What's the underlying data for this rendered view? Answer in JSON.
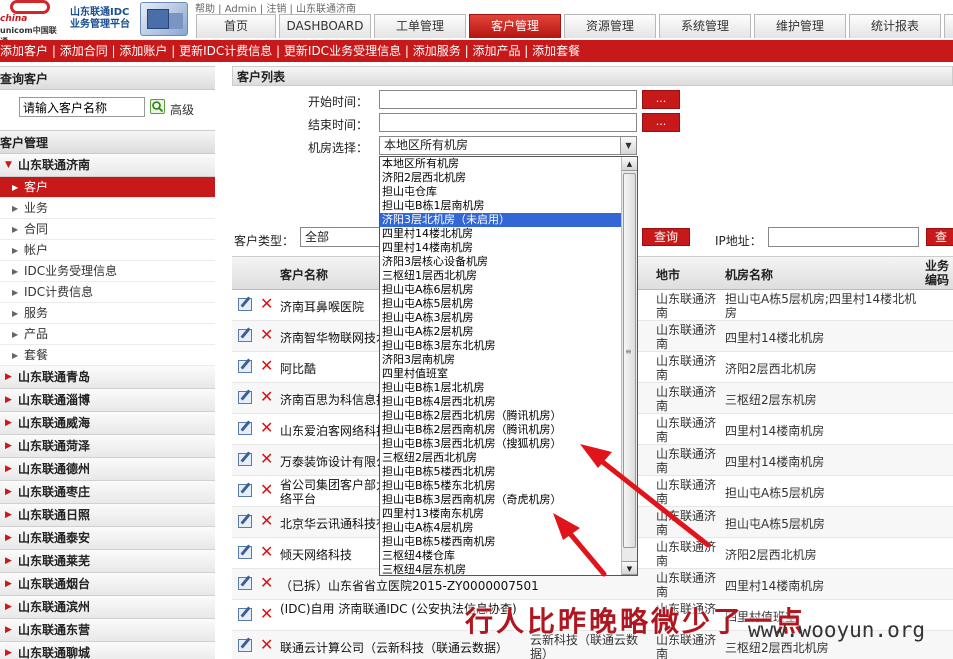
{
  "header": {
    "logo_line1": "china",
    "logo_line2": "unicom中国联通",
    "sublogo_line1": "山东联通IDC",
    "sublogo_line2": "业务管理平台",
    "crumb": "帮助 | Admin | 注销 | 山东联通济南",
    "nav_tabs": [
      "首页",
      "DASHBOARD",
      "工单管理",
      "客户管理",
      "资源管理",
      "系统管理",
      "维护管理",
      "统计报表",
      "运"
    ],
    "active_tab": "客户管理"
  },
  "actionbar": {
    "items": [
      "添加客户",
      "添加合同",
      "添加账户",
      "更新IDC计费信息",
      "更新IDC业务受理信息",
      "添加服务",
      "添加产品",
      "添加套餐"
    ]
  },
  "sidebar": {
    "query_title": "查询客户",
    "search_placeholder": "请输入客户名称",
    "advanced_label": "高级",
    "manage_title": "客户管理",
    "open_group": "山东联通济南",
    "sub_items": [
      "客户",
      "业务",
      "合同",
      "帐户",
      "IDC业务受理信息",
      "IDC计费信息",
      "服务",
      "产品",
      "套餐"
    ],
    "active_sub": "客户",
    "groups": [
      "山东联通青岛",
      "山东联通淄博",
      "山东联通威海",
      "山东联通菏泽",
      "山东联通德州",
      "山东联通枣庄",
      "山东联通日照",
      "山东联通泰安",
      "山东联通莱芜",
      "山东联通烟台",
      "山东联通滨州",
      "山东联通东营",
      "山东联通聊城"
    ]
  },
  "main": {
    "title": "客户列表",
    "start_time_label": "开始时间：",
    "end_time_label": "结束时间：",
    "dots_label": "...",
    "room_label": "机房选择：",
    "room_selected": "本地区所有机房",
    "room_options": [
      "本地区所有机房",
      "济阳2层西北机房",
      "担山屯仓库",
      "担山屯B栋1层南机房",
      "济阳3层北机房（未启用）",
      "四里村14楼北机房",
      "四里村14楼南机房",
      "济阳3层核心设备机房",
      "三枢纽1层西北机房",
      "担山屯A栋6层机房",
      "担山屯A栋5层机房",
      "担山屯A栋3层机房",
      "担山屯A栋2层机房",
      "担山屯B栋3层东北机房",
      "济阳3层南机房",
      "四里村值班室",
      "担山屯B栋1层北机房",
      "担山屯B栋4层西北机房",
      "担山屯B栋2层西北机房（腾讯机房）",
      "担山屯B栋2层西南机房（腾讯机房）",
      "担山屯B栋3层西北机房（搜狐机房）",
      "三枢纽2层西北机房",
      "担山屯B栋5楼西北机房",
      "担山屯B栋5楼东北机房",
      "担山屯B栋3层西南机房（奇虎机房）",
      "四里村13楼南东机房",
      "担山屯A栋4层机房",
      "担山屯B栋5楼西南机房",
      "三枢纽4楼仓库",
      "三枢纽4层东机房"
    ],
    "highlighted_option": "济阳3层北机房（未启用）",
    "type_label": "客户类型：",
    "type_value": "全部",
    "query_label": "查询",
    "ip_label": "IP地址：",
    "query2_label": "查",
    "columns": [
      "客户名称",
      "地市",
      "机房名称",
      "业务编码"
    ],
    "rows": [
      {
        "name": "济南耳鼻喉医院",
        "extra": "",
        "city": "山东联通济南",
        "room": "担山屯A栋5层机房;四里村14楼北机房"
      },
      {
        "name": "济南智华物联网技术有限公司",
        "extra": "",
        "city": "山东联通济南",
        "room": "四里村14楼北机房"
      },
      {
        "name": "阿比酷",
        "extra": "",
        "city": "山东联通济南",
        "room": "济阳2层西北机房"
      },
      {
        "name": "济南百思为科信息技术有限公司",
        "extra": "",
        "city": "山东联通济南",
        "room": "三枢纽2层东机房"
      },
      {
        "name": "山东爱泊客网络科技有限公司",
        "extra": "",
        "city": "山东联通济南",
        "room": "四里村14楼南机房"
      },
      {
        "name": "万泰装饰设计有限公司",
        "extra": "",
        "city": "山东联通济南",
        "room": "四里村14楼南机房"
      },
      {
        "name": "省公司集团客户部大客户网络平台",
        "extra": "",
        "city": "山东联通济南",
        "room": "担山屯A栋5层机房"
      },
      {
        "name": "北京华云讯通科技有限公司",
        "extra": "",
        "city": "山东联通济南",
        "room": "担山屯A栋5层机房"
      },
      {
        "name": "倾天网络科技",
        "extra": "",
        "city": "山东联通济南",
        "room": "济阳2层西北机房"
      },
      {
        "name": "（已拆）山东省省立医院2015-ZY0000007501",
        "extra": "",
        "city": "山东联通济南",
        "room": "四里村14楼南机房"
      },
      {
        "name": "(IDC)自用 济南联通IDC (公安执法信息协查)",
        "extra": "",
        "city": "山东联通济南",
        "room": "四里村值班室"
      },
      {
        "name": "联通云计算公司（云新科技（联通云数据）",
        "extra": "云新科技（联通云数据）",
        "city": "山东联通济南",
        "room": "三枢纽2层西北机房"
      }
    ]
  },
  "watermark": {
    "text": "行人比昨晚略微少了一点",
    "site": "www.wooyun.org"
  },
  "colors": {
    "brand_red": "#c8191a",
    "selection_blue": "#3367d6"
  }
}
